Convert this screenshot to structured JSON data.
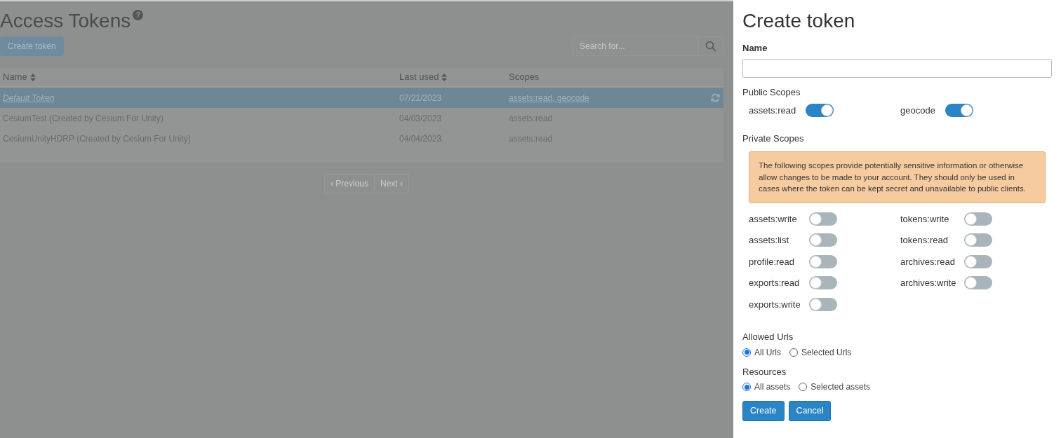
{
  "page": {
    "title": "Access Tokens",
    "help_icon": "?",
    "create_button": "Create token",
    "search": {
      "placeholder": "Search for..."
    },
    "table": {
      "columns": [
        {
          "label": "Name",
          "sortable": true
        },
        {
          "label": "Last used",
          "sortable": true
        },
        {
          "label": "Scopes",
          "sortable": false
        }
      ],
      "rows": [
        {
          "name": "Default Token",
          "last_used": "07/21/2023",
          "scopes": "assets:read, geocode",
          "selected": true
        },
        {
          "name": "CesiumTest (Created by Cesium For Unity)",
          "last_used": "04/03/2023",
          "scopes": "assets:read",
          "selected": false
        },
        {
          "name": "CesiumUnityHDRP (Created by Cesium For Unity)",
          "last_used": "04/04/2023",
          "scopes": "assets:read",
          "selected": false
        }
      ]
    },
    "pagination": {
      "previous": "‹ Previous",
      "next": "Next ›"
    }
  },
  "panel": {
    "title": "Create token",
    "name_label": "Name",
    "public_scopes_label": "Public Scopes",
    "public_scopes": [
      {
        "label": "assets:read",
        "on": true
      },
      {
        "label": "geocode",
        "on": true
      }
    ],
    "private_scopes_label": "Private Scopes",
    "warning": "The following scopes provide potentially sensitive information or otherwise allow changes to be made to your account. They should only be used in cases where the token can be kept secret and unavailable to public clients.",
    "private_scopes": [
      {
        "label": "assets:write",
        "on": false
      },
      {
        "label": "tokens:write",
        "on": false
      },
      {
        "label": "assets:list",
        "on": false
      },
      {
        "label": "tokens:read",
        "on": false
      },
      {
        "label": "profile:read",
        "on": false
      },
      {
        "label": "archives:read",
        "on": false
      },
      {
        "label": "exports:read",
        "on": false
      },
      {
        "label": "archives:write",
        "on": false
      },
      {
        "label": "exports:write",
        "on": false
      }
    ],
    "allowed_urls": {
      "label": "Allowed Urls",
      "options": [
        {
          "label": "All Urls",
          "selected": true
        },
        {
          "label": "Selected Urls",
          "selected": false
        }
      ]
    },
    "resources": {
      "label": "Resources",
      "options": [
        {
          "label": "All assets",
          "selected": true
        },
        {
          "label": "Selected assets",
          "selected": false
        }
      ]
    },
    "buttons": [
      "Create",
      "Cancel"
    ]
  }
}
